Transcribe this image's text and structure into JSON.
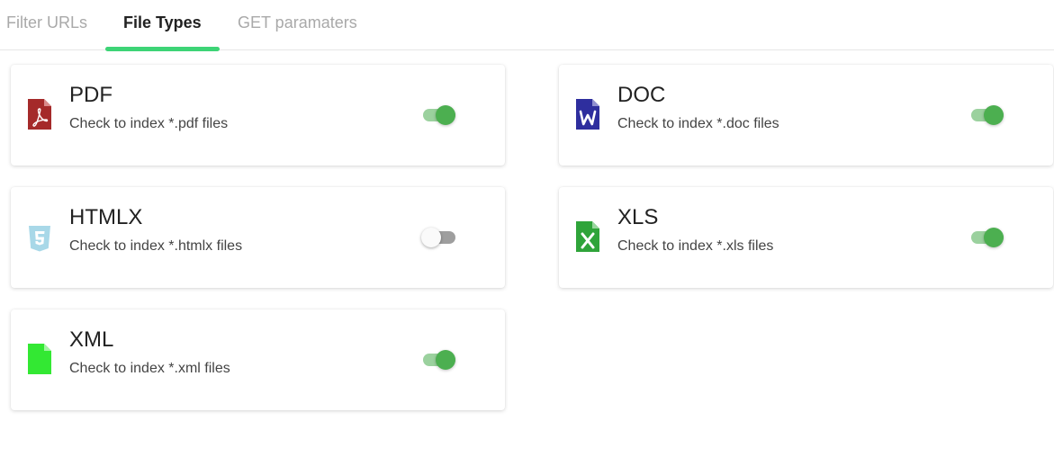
{
  "tabs": [
    {
      "label": "Filter URLs",
      "active": false
    },
    {
      "label": "File Types",
      "active": true
    },
    {
      "label": "GET paramaters",
      "active": false
    }
  ],
  "accent_color": "#3dd476",
  "file_types": [
    {
      "title": "PDF",
      "description": "Check to index *.pdf files",
      "icon": "pdf-file-icon",
      "icon_color": "#a52a2a",
      "enabled": true
    },
    {
      "title": "DOC",
      "description": "Check to index *.doc files",
      "icon": "word-file-icon",
      "icon_color": "#2e2e9e",
      "enabled": true
    },
    {
      "title": "HTMLX",
      "description": "Check to index *.htmlx files",
      "icon": "html5-icon",
      "icon_color": "#a8d8e8",
      "enabled": false
    },
    {
      "title": "XLS",
      "description": "Check to index *.xls files",
      "icon": "excel-file-icon",
      "icon_color": "#2fa43a",
      "enabled": true
    },
    {
      "title": "XML",
      "description": "Check to index *.xml files",
      "icon": "xml-file-icon",
      "icon_color": "#33e833",
      "enabled": true
    }
  ]
}
